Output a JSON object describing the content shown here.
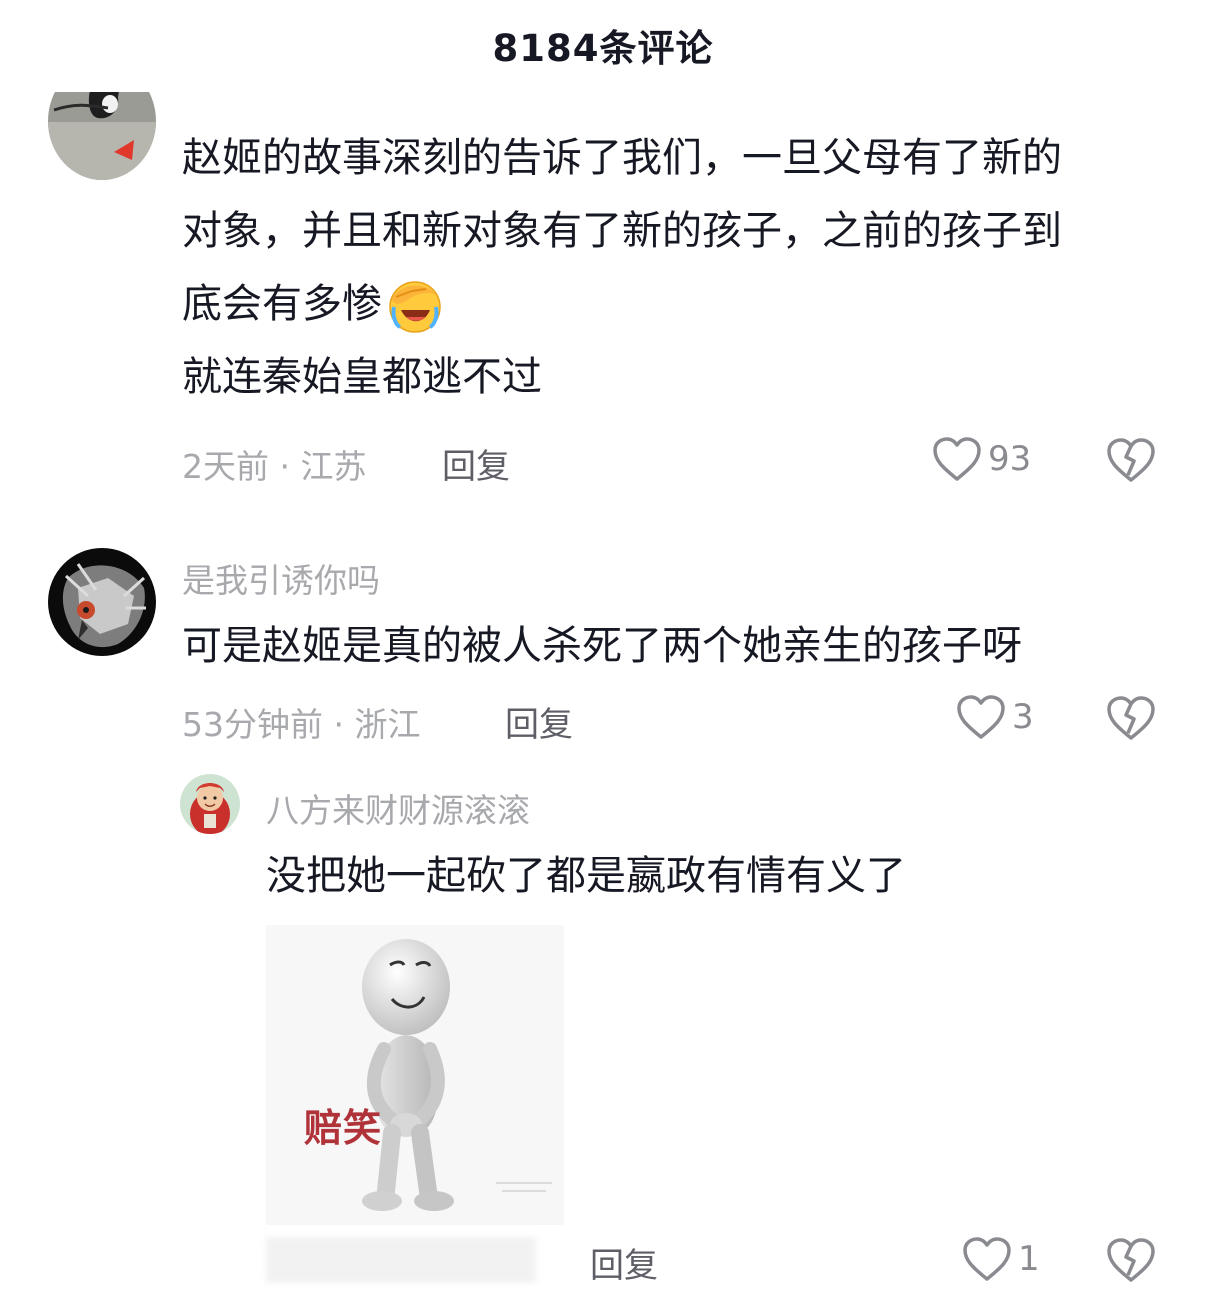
{
  "header": {
    "title": "8184条评论"
  },
  "comments": [
    {
      "username": "",
      "text_lines": [
        "赵姬的故事深刻的告诉了我们，一旦父母有了新的",
        "对象，并且和新对象有了新的孩子，之前的孩子到",
        "底会有多惨"
      ],
      "text_after": "就连秦始皇都逃不过",
      "meta": "2天前 · 江苏",
      "reply": "回复",
      "likes": "93"
    },
    {
      "username": "是我引诱你吗",
      "text": "可是赵姬是真的被人杀死了两个她亲生的孩子呀",
      "meta": "53分钟前 · 浙江",
      "reply": "回复",
      "likes": "3",
      "replies": [
        {
          "username": "八方来财财源滚滚",
          "text": "没把她一起砍了都是嬴政有情有义了",
          "sticker_label": "赔笑",
          "reply": "回复",
          "likes": "1"
        }
      ]
    }
  ],
  "icons": {
    "like": "heart-outline-icon",
    "dislike": "broken-heart-icon",
    "emoji": "facepalm-laughing-emoji"
  },
  "colors": {
    "text_primary": "#161823",
    "text_secondary": "#a8a9ad",
    "sticker_label": "#b0333a"
  }
}
